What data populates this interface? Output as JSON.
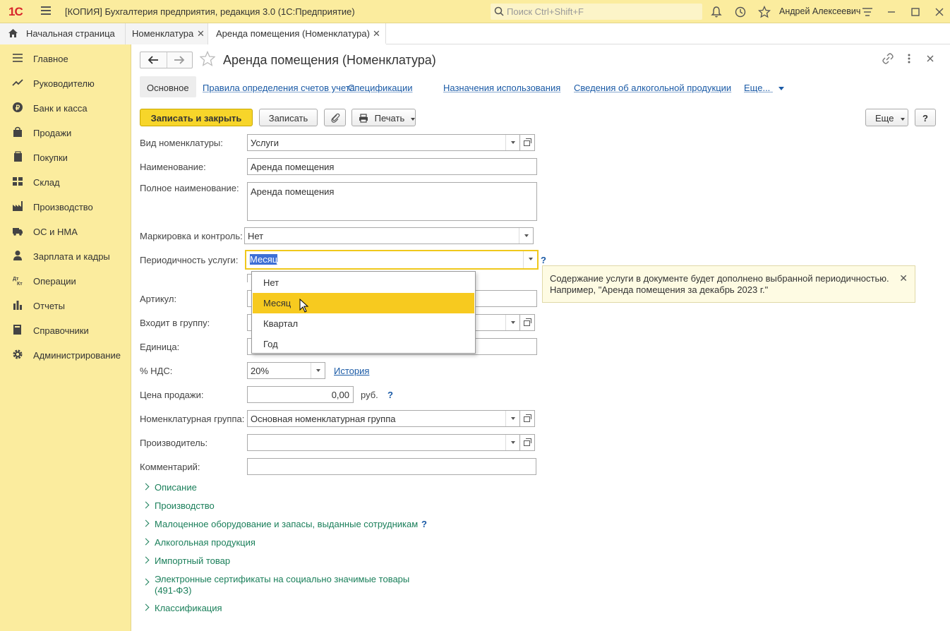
{
  "titlebar": {
    "logo": "1С",
    "title": "[КОПИЯ] Бухгалтерия предприятия, редакция 3.0  (1С:Предприятие)",
    "search_placeholder": "Поиск Ctrl+Shift+F",
    "user": "Андрей Алексеевич"
  },
  "tabs": [
    {
      "label": "Начальная страница"
    },
    {
      "label": "Номенклатура"
    },
    {
      "label": "Аренда помещения (Номенклатура)"
    }
  ],
  "sidebar": {
    "items": [
      {
        "label": "Главное",
        "icon": "menu-icon"
      },
      {
        "label": "Руководителю",
        "icon": "trend-icon"
      },
      {
        "label": "Банк и касса",
        "icon": "ruble-icon"
      },
      {
        "label": "Продажи",
        "icon": "bag-icon"
      },
      {
        "label": "Покупки",
        "icon": "cart-icon"
      },
      {
        "label": "Склад",
        "icon": "warehouse-icon"
      },
      {
        "label": "Производство",
        "icon": "factory-icon"
      },
      {
        "label": "ОС и НМА",
        "icon": "truck-icon"
      },
      {
        "label": "Зарплата и кадры",
        "icon": "person-icon"
      },
      {
        "label": "Операции",
        "icon": "dt-kt-icon"
      },
      {
        "label": "Отчеты",
        "icon": "bar-chart-icon"
      },
      {
        "label": "Справочники",
        "icon": "book-icon"
      },
      {
        "label": "Администрирование",
        "icon": "gear-icon"
      }
    ]
  },
  "form": {
    "title": "Аренда помещения (Номенклатура)",
    "subtabs": [
      "Основное",
      "Правила определения счетов учета",
      "Спецификации",
      "Назначения использования",
      "Сведения об алкогольной продукции",
      "Еще..."
    ],
    "buttons": {
      "save_close": "Записать и закрыть",
      "save": "Записать",
      "print": "Печать",
      "more": "Еще",
      "help": "?"
    },
    "labels": {
      "kind": "Вид номенклатуры:",
      "name": "Наименование:",
      "full_name": "Полное наименование:",
      "marking": "Маркировка и контроль:",
      "periodicity": "Периодичность услуги:",
      "article": "Артикул:",
      "group": "Входит в группу:",
      "unit": "Единица:",
      "vat": "% НДС:",
      "price": "Цена продажи:",
      "nom_group": "Номенклатурная группа:",
      "manufacturer": "Производитель:",
      "comment": "Комментарий:"
    },
    "values": {
      "kind": "Услуги",
      "name": "Аренда помещения",
      "full_name": "Аренда помещения",
      "marking": "Нет",
      "periodicity": "Месяц",
      "article": "",
      "group": "",
      "unit": "",
      "vat": "20%",
      "price": "0,00",
      "currency": "руб.",
      "nom_group": "Основная номенклатурная группа",
      "manufacturer": "",
      "comment": ""
    },
    "history_link": "История",
    "help_mark": "?",
    "groups": [
      {
        "label": "Описание"
      },
      {
        "label": "Производство"
      },
      {
        "label": "Малоценное оборудование и запасы, выданные сотрудникам",
        "help": "?"
      },
      {
        "label": "Алкогольная продукция"
      },
      {
        "label": "Импортный товар"
      },
      {
        "label": "Электронные сертификаты на социально значимые товары",
        "label2": "(491-ФЗ)"
      },
      {
        "label": "Классификация"
      }
    ]
  },
  "popup": {
    "options": [
      "Нет",
      "Месяц",
      "Квартал",
      "Год"
    ],
    "highlighted": "Месяц"
  },
  "tooltip": {
    "text1": "Содержание услуги в документе будет дополнено выбранной периодичностью.",
    "text2": "Например, \"Аренда помещения за декабрь 2023 г.\""
  },
  "colors": {
    "accent": "#f7d52a",
    "sidebar_bg": "#fbec9e",
    "link": "#1a5aa6",
    "group_link": "#1a7f5a"
  }
}
